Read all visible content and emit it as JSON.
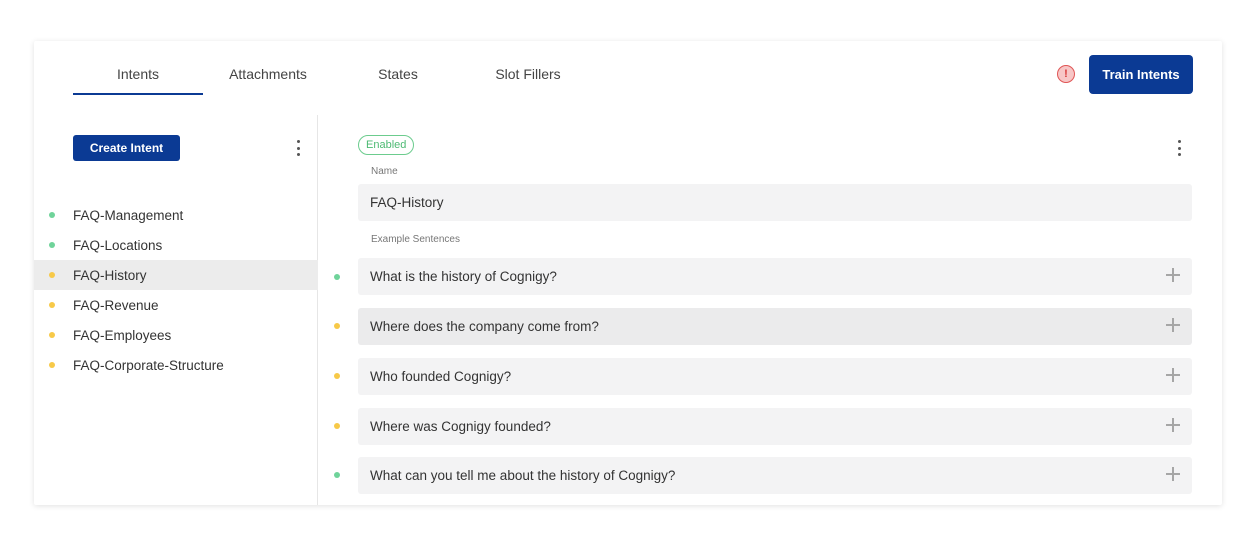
{
  "tabs": [
    {
      "label": "Intents",
      "active": true
    },
    {
      "label": "Attachments",
      "active": false
    },
    {
      "label": "States",
      "active": false
    },
    {
      "label": "Slot Fillers",
      "active": false
    }
  ],
  "header": {
    "warning_icon_glyph": "!",
    "train_label": "Train Intents"
  },
  "sidebar": {
    "create_label": "Create Intent",
    "items": [
      {
        "label": "FAQ-Management",
        "status_color": "#6fd39a",
        "selected": false
      },
      {
        "label": "FAQ-Locations",
        "status_color": "#6fd39a",
        "selected": false
      },
      {
        "label": "FAQ-History",
        "status_color": "#f7c948",
        "selected": true
      },
      {
        "label": "FAQ-Revenue",
        "status_color": "#f7c948",
        "selected": false
      },
      {
        "label": "FAQ-Employees",
        "status_color": "#f7c948",
        "selected": false
      },
      {
        "label": "FAQ-Corporate-Structure",
        "status_color": "#f7c948",
        "selected": false
      }
    ]
  },
  "detail": {
    "status_badge": "Enabled",
    "name_label": "Name",
    "name_value": "FAQ-History",
    "sentences_label": "Example Sentences",
    "sentences": [
      {
        "text": "What is the history of Cognigy?",
        "status_color": "#6fd39a"
      },
      {
        "text": "Where does the company come from?",
        "status_color": "#f7c948"
      },
      {
        "text": "Who founded Cognigy?",
        "status_color": "#f7c948"
      },
      {
        "text": "Where was Cognigy founded?",
        "status_color": "#f7c948"
      },
      {
        "text": "What can you tell me about the history of Cognigy?",
        "status_color": "#6fd39a"
      }
    ]
  },
  "colors": {
    "accent": "#0b3a94",
    "status_trained": "#6fd39a",
    "status_pending": "#f7c948",
    "warning": "#e05555"
  }
}
